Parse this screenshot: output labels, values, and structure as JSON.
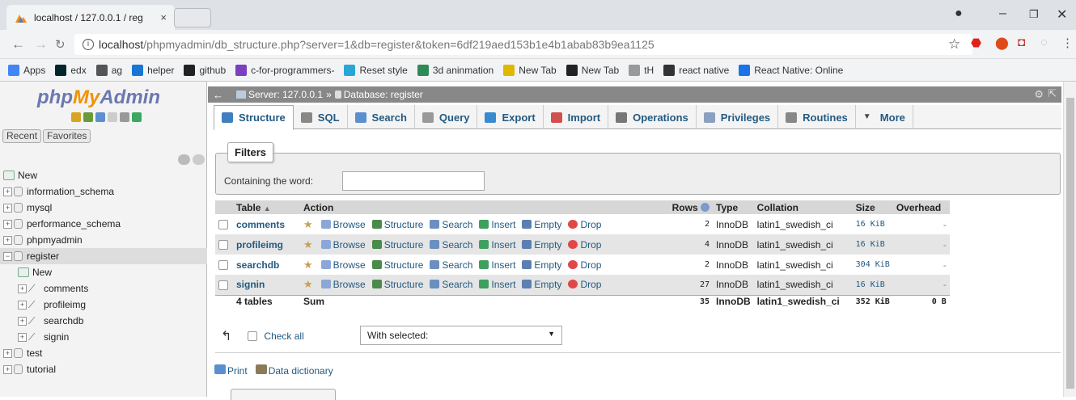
{
  "browser": {
    "tab_title": "localhost / 127.0.0.1 / reg",
    "tab_close": "×",
    "url_host": "localhost",
    "url_path": "/phpmyadmin/db_structure.php?server=1&db=register&token=6df219aed153b1e4b1abab83b9ea1125",
    "bookmarks": [
      {
        "label": "Apps",
        "color": "#4285f4"
      },
      {
        "label": "edx",
        "color": "#02262b"
      },
      {
        "label": "ag",
        "color": "#555555"
      },
      {
        "label": "helper",
        "color": "#1976d2"
      },
      {
        "label": "github",
        "color": "#222222"
      },
      {
        "label": "c-for-programmers-",
        "color": "#7b3fbf"
      },
      {
        "label": "Reset style",
        "color": "#2aa6d6"
      },
      {
        "label": "3d aninmation",
        "color": "#2e8b57"
      },
      {
        "label": "New Tab",
        "color": "#e0b800"
      },
      {
        "label": "New Tab",
        "color": "#222222"
      },
      {
        "label": "tH",
        "color": "#999999"
      },
      {
        "label": "react native",
        "color": "#333333"
      },
      {
        "label": "React Native: Online",
        "color": "#1a73e8"
      }
    ]
  },
  "sidebar": {
    "logo_php": "php",
    "logo_my": "My",
    "logo_admin": "Admin",
    "recent": "Recent",
    "favorites": "Favorites",
    "tree": [
      {
        "label": "New",
        "kind": "new",
        "indent": 0
      },
      {
        "label": "information_schema",
        "kind": "db",
        "indent": 0
      },
      {
        "label": "mysql",
        "kind": "db",
        "indent": 0
      },
      {
        "label": "performance_schema",
        "kind": "db",
        "indent": 0
      },
      {
        "label": "phpmyadmin",
        "kind": "db",
        "indent": 0
      },
      {
        "label": "register",
        "kind": "db-open",
        "indent": 0
      },
      {
        "label": "New",
        "kind": "new",
        "indent": 1
      },
      {
        "label": "comments",
        "kind": "table",
        "indent": 1
      },
      {
        "label": "profileimg",
        "kind": "table",
        "indent": 1
      },
      {
        "label": "searchdb",
        "kind": "table",
        "indent": 1
      },
      {
        "label": "signin",
        "kind": "table",
        "indent": 1
      },
      {
        "label": "test",
        "kind": "db",
        "indent": 0
      },
      {
        "label": "tutorial",
        "kind": "db",
        "indent": 0
      }
    ]
  },
  "breadcrumb": {
    "server": "Server: 127.0.0.1",
    "separator": "»",
    "database": "Database: register"
  },
  "tabs": [
    {
      "label": "Structure",
      "active": true,
      "color": "#3f7fbf"
    },
    {
      "label": "SQL",
      "active": false,
      "color": "#888888"
    },
    {
      "label": "Search",
      "active": false,
      "color": "#5b8fd0"
    },
    {
      "label": "Query",
      "active": false,
      "color": "#999999"
    },
    {
      "label": "Export",
      "active": false,
      "color": "#3a8ad0"
    },
    {
      "label": "Import",
      "active": false,
      "color": "#d05050"
    },
    {
      "label": "Operations",
      "active": false,
      "color": "#777777"
    },
    {
      "label": "Privileges",
      "active": false,
      "color": "#8aa0c0"
    },
    {
      "label": "Routines",
      "active": false,
      "color": "#888888"
    },
    {
      "label": "More",
      "active": false,
      "color": "#444444"
    }
  ],
  "filters": {
    "legend": "Filters",
    "label": "Containing the word:",
    "value": ""
  },
  "table": {
    "headers": {
      "table": "Table",
      "action": "Action",
      "rows": "Rows",
      "type": "Type",
      "collation": "Collation",
      "size": "Size",
      "overhead": "Overhead"
    },
    "actions": [
      "Browse",
      "Structure",
      "Search",
      "Insert",
      "Empty",
      "Drop"
    ],
    "rows": [
      {
        "name": "comments",
        "rows": "2",
        "type": "InnoDB",
        "collation": "latin1_swedish_ci",
        "size": "16 KiB",
        "overhead": "-"
      },
      {
        "name": "profileimg",
        "rows": "4",
        "type": "InnoDB",
        "collation": "latin1_swedish_ci",
        "size": "16 KiB",
        "overhead": "-"
      },
      {
        "name": "searchdb",
        "rows": "2",
        "type": "InnoDB",
        "collation": "latin1_swedish_ci",
        "size": "304 KiB",
        "overhead": "-"
      },
      {
        "name": "signin",
        "rows": "27",
        "type": "InnoDB",
        "collation": "latin1_swedish_ci",
        "size": "16 KiB",
        "overhead": "-"
      }
    ],
    "summary": {
      "tables": "4 tables",
      "sum": "Sum",
      "rows": "35",
      "type": "InnoDB",
      "collation": "latin1_swedish_ci",
      "size": "352 KiB",
      "overhead": "0 B"
    }
  },
  "bulk": {
    "check_all": "Check all",
    "with_selected": "With selected:"
  },
  "footer_links": {
    "print": "Print",
    "data_dictionary": "Data dictionary"
  },
  "action_colors": {
    "Browse": "#8aa7d8",
    "Structure": "#4a8a4a",
    "Search": "#6a8fc0",
    "Insert": "#3f9f5f",
    "Empty": "#5b7fb0",
    "Drop": "#e04848"
  }
}
